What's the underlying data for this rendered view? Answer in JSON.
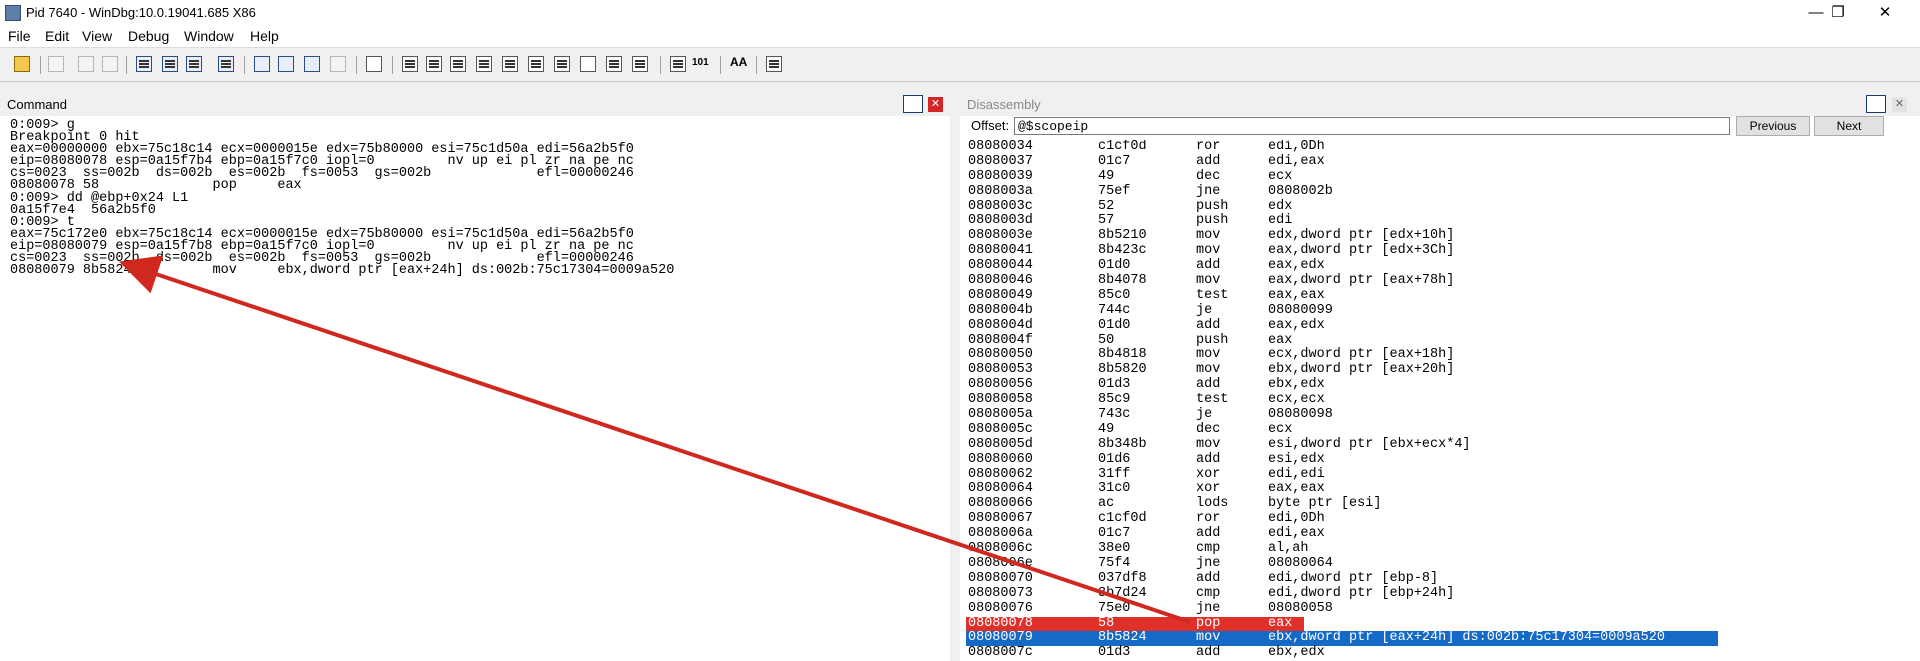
{
  "window": {
    "title": "Pid 7640 - WinDbg:10.0.19041.685 X86",
    "minimize": "—",
    "restore": "❐",
    "close": "✕"
  },
  "menu": [
    "File",
    "Edit",
    "View",
    "Debug",
    "Window",
    "Help"
  ],
  "toolbar": {
    "font_button": "AA",
    "source_mode_text": "101"
  },
  "command_pane": {
    "title": "Command",
    "lines": [
      "0:009> g",
      "Breakpoint 0 hit",
      "eax=00000000 ebx=75c18c14 ecx=0000015e edx=75b80000 esi=75c1d50a edi=56a2b5f0",
      "eip=08080078 esp=0a15f7b4 ebp=0a15f7c0 iopl=0         nv up ei pl zr na pe nc",
      "cs=0023  ss=002b  ds=002b  es=002b  fs=0053  gs=002b             efl=00000246",
      "08080078 58              pop     eax",
      "0:009> dd @ebp+0x24 L1",
      "0a15f7e4  56a2b5f0",
      "0:009> t",
      "eax=75c172e0 ebx=75c18c14 ecx=0000015e edx=75b80000 esi=75c1d50a edi=56a2b5f0",
      "eip=08080079 esp=0a15f7b8 ebp=0a15f7c0 iopl=0         nv up ei pl zr na pe nc",
      "cs=0023  ss=002b  ds=002b  es=002b  fs=0053  gs=002b             efl=00000246",
      "08080079 8b5824          mov     ebx,dword ptr [eax+24h] ds:002b:75c17304=0009a520"
    ]
  },
  "disassembly_pane": {
    "title": "Disassembly",
    "offset_label": "Offset:",
    "offset_value": "@$scopeip",
    "previous_label": "Previous",
    "next_label": "Next",
    "lines": [
      {
        "addr": "08080034",
        "op": "c1cf0d",
        "mn": "ror",
        "args": "edi,0Dh"
      },
      {
        "addr": "08080037",
        "op": "01c7",
        "mn": "add",
        "args": "edi,eax"
      },
      {
        "addr": "08080039",
        "op": "49",
        "mn": "dec",
        "args": "ecx"
      },
      {
        "addr": "0808003a",
        "op": "75ef",
        "mn": "jne",
        "args": "0808002b"
      },
      {
        "addr": "0808003c",
        "op": "52",
        "mn": "push",
        "args": "edx"
      },
      {
        "addr": "0808003d",
        "op": "57",
        "mn": "push",
        "args": "edi"
      },
      {
        "addr": "0808003e",
        "op": "8b5210",
        "mn": "mov",
        "args": "edx,dword ptr [edx+10h]"
      },
      {
        "addr": "08080041",
        "op": "8b423c",
        "mn": "mov",
        "args": "eax,dword ptr [edx+3Ch]"
      },
      {
        "addr": "08080044",
        "op": "01d0",
        "mn": "add",
        "args": "eax,edx"
      },
      {
        "addr": "08080046",
        "op": "8b4078",
        "mn": "mov",
        "args": "eax,dword ptr [eax+78h]"
      },
      {
        "addr": "08080049",
        "op": "85c0",
        "mn": "test",
        "args": "eax,eax"
      },
      {
        "addr": "0808004b",
        "op": "744c",
        "mn": "je",
        "args": "08080099"
      },
      {
        "addr": "0808004d",
        "op": "01d0",
        "mn": "add",
        "args": "eax,edx"
      },
      {
        "addr": "0808004f",
        "op": "50",
        "mn": "push",
        "args": "eax"
      },
      {
        "addr": "08080050",
        "op": "8b4818",
        "mn": "mov",
        "args": "ecx,dword ptr [eax+18h]"
      },
      {
        "addr": "08080053",
        "op": "8b5820",
        "mn": "mov",
        "args": "ebx,dword ptr [eax+20h]"
      },
      {
        "addr": "08080056",
        "op": "01d3",
        "mn": "add",
        "args": "ebx,edx"
      },
      {
        "addr": "08080058",
        "op": "85c9",
        "mn": "test",
        "args": "ecx,ecx"
      },
      {
        "addr": "0808005a",
        "op": "743c",
        "mn": "je",
        "args": "08080098"
      },
      {
        "addr": "0808005c",
        "op": "49",
        "mn": "dec",
        "args": "ecx"
      },
      {
        "addr": "0808005d",
        "op": "8b348b",
        "mn": "mov",
        "args": "esi,dword ptr [ebx+ecx*4]"
      },
      {
        "addr": "08080060",
        "op": "01d6",
        "mn": "add",
        "args": "esi,edx"
      },
      {
        "addr": "08080062",
        "op": "31ff",
        "mn": "xor",
        "args": "edi,edi"
      },
      {
        "addr": "08080064",
        "op": "31c0",
        "mn": "xor",
        "args": "eax,eax"
      },
      {
        "addr": "08080066",
        "op": "ac",
        "mn": "lods",
        "args": "byte ptr [esi]"
      },
      {
        "addr": "08080067",
        "op": "c1cf0d",
        "mn": "ror",
        "args": "edi,0Dh"
      },
      {
        "addr": "0808006a",
        "op": "01c7",
        "mn": "add",
        "args": "edi,eax"
      },
      {
        "addr": "0808006c",
        "op": "38e0",
        "mn": "cmp",
        "args": "al,ah"
      },
      {
        "addr": "0808006e",
        "op": "75f4",
        "mn": "jne",
        "args": "08080064"
      },
      {
        "addr": "08080070",
        "op": "037df8",
        "mn": "add",
        "args": "edi,dword ptr [ebp-8]"
      },
      {
        "addr": "08080073",
        "op": "3b7d24",
        "mn": "cmp",
        "args": "edi,dword ptr [ebp+24h]"
      },
      {
        "addr": "08080076",
        "op": "75e0",
        "mn": "jne",
        "args": "08080058"
      },
      {
        "addr": "08080078",
        "op": "58",
        "mn": "pop",
        "args": "eax",
        "hl": "red"
      },
      {
        "addr": "08080079",
        "op": "8b5824",
        "mn": "mov",
        "args": "ebx,dword ptr [eax+24h] ds:002b:75c17304=0009a520",
        "hl": "blue"
      },
      {
        "addr": "0808007c",
        "op": "01d3",
        "mn": "add",
        "args": "ebx,edx"
      }
    ]
  },
  "colors": {
    "breakpoint_line": "#e0302a",
    "current_line": "#1569c7",
    "annotation_arrow": "#d0281e"
  }
}
